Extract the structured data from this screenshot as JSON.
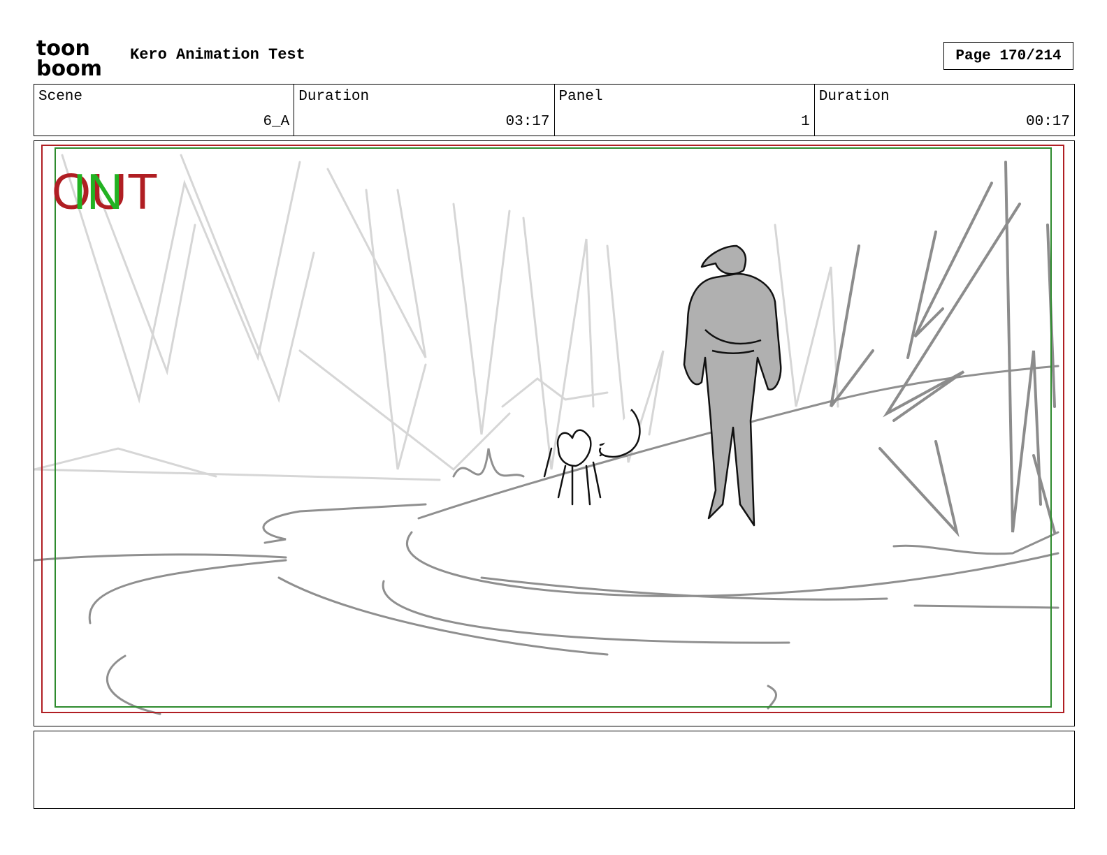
{
  "header": {
    "logo": {
      "line1": "toon",
      "line2": "boom",
      "icon": "toonboom-logo"
    },
    "project_title": "Kero Animation Test",
    "page_label": "Page 170/214"
  },
  "info": [
    {
      "label": "Scene",
      "value": "6_A"
    },
    {
      "label": "Duration",
      "value": "03:17"
    },
    {
      "label": "Panel",
      "value": "1"
    },
    {
      "label": "Duration",
      "value": "00:17"
    }
  ],
  "panel": {
    "overlay_out": "OUT",
    "overlay_in": "IN",
    "colors": {
      "out_frame": "#b01e23",
      "in_frame": "#2e8b2e",
      "sketch_light": "#d4d4d4",
      "sketch_mid": "#8c8c8c"
    }
  },
  "caption": ""
}
